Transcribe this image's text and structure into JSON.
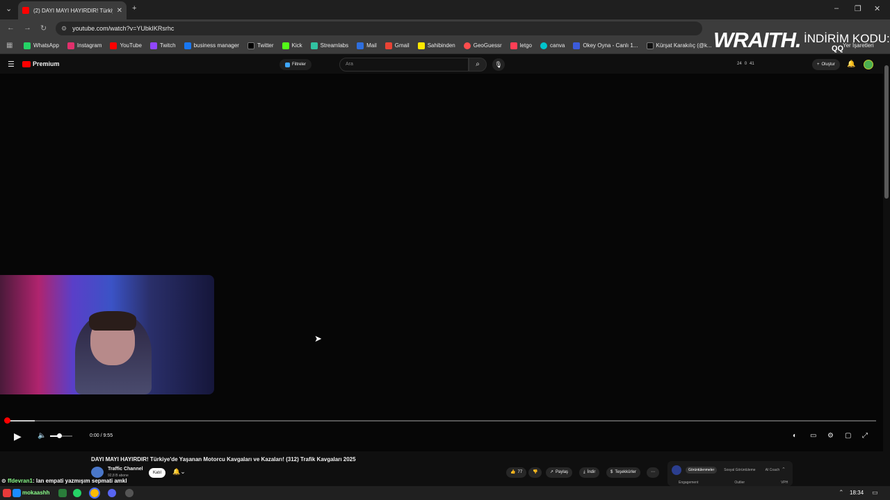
{
  "browser": {
    "tab_title": "(2) DAYI MAYI HAYIRDIR! Türkiy",
    "url": "youtube.com/watch?v=YUbkIKRsrhc",
    "bookmarks": [
      {
        "label": "WhatsApp",
        "color": "#25d366"
      },
      {
        "label": "Instagram",
        "color": "#e1306c"
      },
      {
        "label": "YouTube",
        "color": "#ff0000"
      },
      {
        "label": "Twitch",
        "color": "#9146ff"
      },
      {
        "label": "business manager",
        "color": "#1877f2"
      },
      {
        "label": "Twitter",
        "color": "#000000"
      },
      {
        "label": "Kick",
        "color": "#53fc18"
      },
      {
        "label": "Streamlabs",
        "color": "#31c3a2"
      },
      {
        "label": "Mail",
        "color": "#2f6fde"
      },
      {
        "label": "Gmail",
        "color": "#ea4335"
      },
      {
        "label": "Sahibinden",
        "color": "#ffe800"
      },
      {
        "label": "GeoGuessr",
        "color": "#ff4d4d"
      },
      {
        "label": "letgo",
        "color": "#ff3f55"
      },
      {
        "label": "canva",
        "color": "#00c4cc"
      },
      {
        "label": "Okey Oyna - Canlı 1...",
        "color": "#3b5bdb"
      },
      {
        "label": "Kürşat Karakılıç (@k...",
        "color": "#111111"
      }
    ],
    "bookmarks_more": "Yer İşaretleri"
  },
  "youtube": {
    "logo": "Premium",
    "filters_label": "Filtreler",
    "search_placeholder": "Ara",
    "stats": [
      "24",
      "0",
      "41"
    ],
    "create_label": "Oluştur",
    "notification_count": "2"
  },
  "overlay": {
    "brand": "WRAITH.",
    "code_label": "İNDİRİM KODU:",
    "code_value": "QQ"
  },
  "player": {
    "time": "0:00 / 9:55",
    "progress": 0.0
  },
  "video": {
    "title": "DAYI MAYI HAYIRDIR! Türkiye'de Yaşanan Motorcu Kavgaları ve Kazaları! (312) Trafik Kavgaları 2025",
    "channel": "Traffic Channel",
    "subscribers": "92,8 B abone",
    "join_label": "Katıl",
    "likes": "77",
    "share_label": "Paylaş",
    "download_label": "İndir",
    "thanks_label": "Teşekkürler"
  },
  "panel": {
    "tabs": [
      "Görüntülenmeler",
      "Sosyal Görüntüleme",
      "AI Coach"
    ],
    "headers": [
      "Engagement",
      "Outlier",
      "VPH"
    ]
  },
  "chat": {
    "user": "ffdevran1",
    "message": ": lan empati yazmışım sepmati amkl"
  },
  "taskbar": {
    "app_label": "mokaashh",
    "time": "18:34"
  }
}
